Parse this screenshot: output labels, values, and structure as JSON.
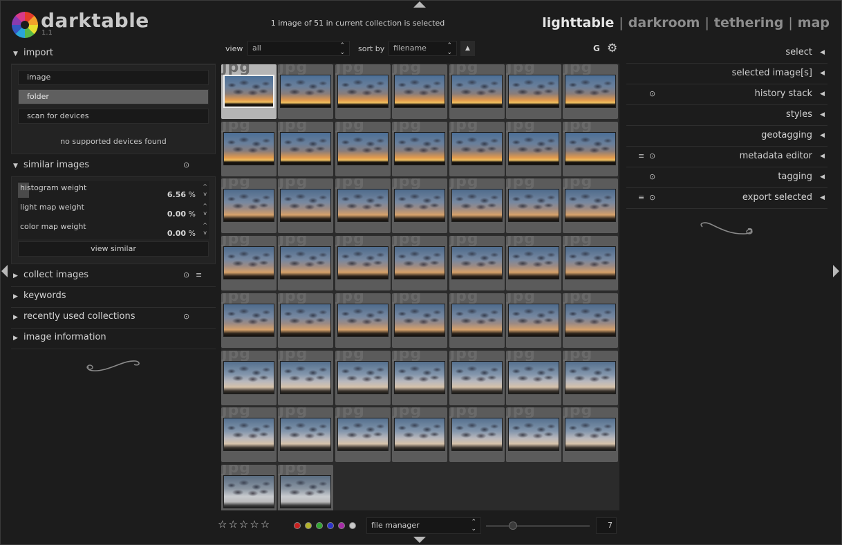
{
  "app": {
    "name": "darktable",
    "version": "1.1"
  },
  "status_text": "1 image of 51 in current collection is selected",
  "views": [
    "lighttable",
    "darkroom",
    "tethering",
    "map"
  ],
  "views_sep": "|",
  "left_panel": {
    "import": {
      "title": "import",
      "buttons": [
        "image",
        "folder",
        "scan for devices"
      ],
      "message": "no supported devices found"
    },
    "similar": {
      "title": "similar images",
      "sliders": [
        {
          "label": "histogram weight",
          "value": "6.56",
          "unit": "%",
          "fraction": 0.0656
        },
        {
          "label": "light map weight",
          "value": "0.00",
          "unit": "%",
          "fraction": 0.0
        },
        {
          "label": "color map weight",
          "value": "0.00",
          "unit": "%",
          "fraction": 0.0
        }
      ],
      "button": "view similar"
    },
    "collapsed": [
      {
        "title": "collect images"
      },
      {
        "title": "keywords"
      },
      {
        "title": "recently used collections"
      },
      {
        "title": "image information"
      }
    ]
  },
  "toolbar": {
    "view_label": "view",
    "view_value": "all",
    "sort_label": "sort by",
    "sort_value": "filename",
    "grouping": "G"
  },
  "grid": {
    "columns": 7,
    "total": 51,
    "visible": 51,
    "selected_index": 0,
    "ext_label": "jpg"
  },
  "right_panel": {
    "modules": [
      "select",
      "selected image[s]",
      "history stack",
      "styles",
      "geotagging",
      "metadata editor",
      "tagging",
      "export selected"
    ]
  },
  "bottom": {
    "stars": "☆☆☆☆☆",
    "color_labels": [
      "#c8201f",
      "#b3b32a",
      "#31a531",
      "#2b33c9",
      "#a62ba6",
      "#c9c9c9"
    ],
    "layout_value": "file manager",
    "zoom_value": "7"
  },
  "icons": {
    "gear": "gear-icon",
    "up": "chevron-up-icon",
    "reset": "reset-icon",
    "presets": "presets-icon"
  }
}
